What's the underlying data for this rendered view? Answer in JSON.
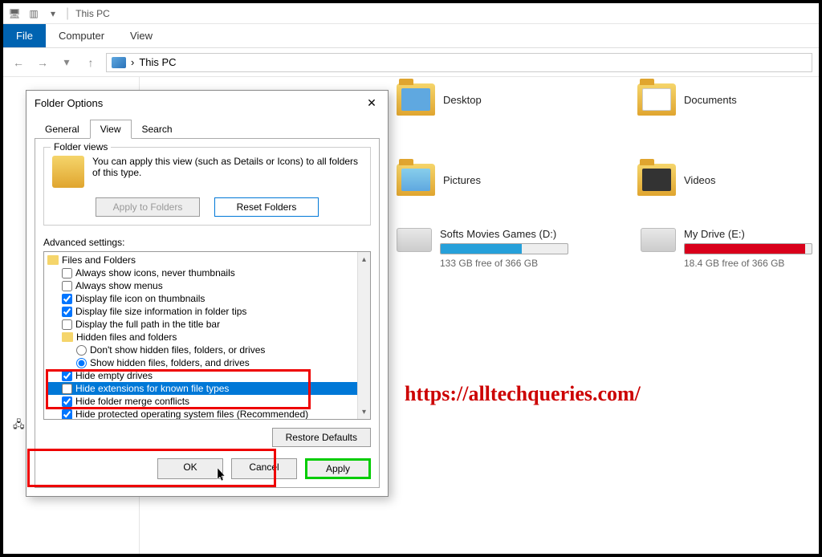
{
  "titlebar": {
    "title": "This PC"
  },
  "ribbon": {
    "file": "File",
    "computer": "Computer",
    "view": "View"
  },
  "navbar": {
    "path": "This PC"
  },
  "folders": {
    "desktop": "Desktop",
    "documents": "Documents",
    "pictures": "Pictures",
    "videos": "Videos"
  },
  "drives": {
    "d": {
      "name": "Softs Movies Games (D:)",
      "free": "133 GB free of 366 GB",
      "fill_pct": 64,
      "fill_color": "#26a0da"
    },
    "e": {
      "name": "My Drive (E:)",
      "free": "18.4 GB free of 366 GB",
      "fill_pct": 95,
      "fill_color": "#d9001b"
    }
  },
  "sidebar": {
    "network": "Network"
  },
  "watermark": "https://alltechqueries.com/",
  "dialog": {
    "title": "Folder Options",
    "tabs": {
      "general": "General",
      "view": "View",
      "search": "Search"
    },
    "folder_views": {
      "legend": "Folder views",
      "text": "You can apply this view (such as Details or Icons) to all folders of this type.",
      "apply": "Apply to Folders",
      "reset": "Reset Folders"
    },
    "advanced_label": "Advanced settings:",
    "items": {
      "files_folders": "Files and Folders",
      "always_icons": "Always show icons, never thumbnails",
      "always_menus": "Always show menus",
      "display_file_icon": "Display file icon on thumbnails",
      "display_file_size": "Display file size information in folder tips",
      "display_full_path": "Display the full path in the title bar",
      "hidden_files": "Hidden files and folders",
      "dont_show_hidden": "Don't show hidden files, folders, or drives",
      "show_hidden": "Show hidden files, folders, and drives",
      "hide_empty": "Hide empty drives",
      "hide_extensions": "Hide extensions for known file types",
      "hide_merge": "Hide folder merge conflicts",
      "hide_protected": "Hide protected operating system files (Recommended)"
    },
    "restore": "Restore Defaults",
    "ok": "OK",
    "cancel": "Cancel",
    "apply": "Apply"
  }
}
